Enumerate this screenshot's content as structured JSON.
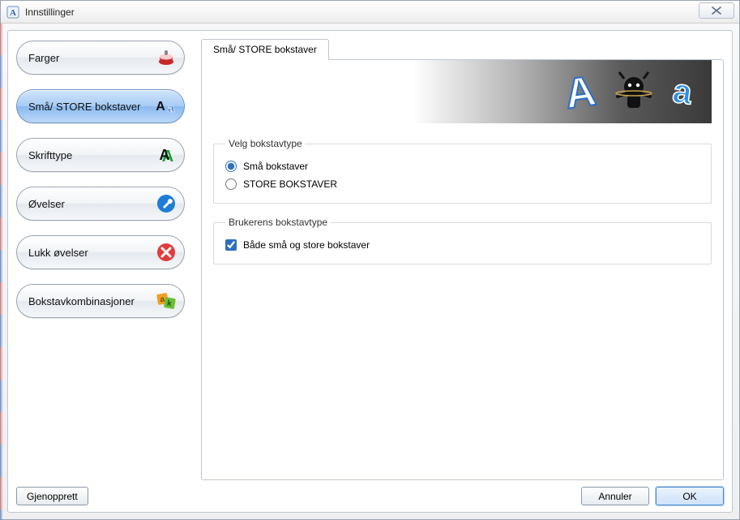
{
  "window": {
    "title": "Innstillinger"
  },
  "sidebar": {
    "items": [
      {
        "label": "Farger",
        "icon": "paint-bucket-icon"
      },
      {
        "label": "Små/ STORE bokstaver",
        "icon": "letters-aa-icon"
      },
      {
        "label": "Skrifttype",
        "icon": "font-a-icon"
      },
      {
        "label": "Øvelser",
        "icon": "wrench-icon"
      },
      {
        "label": "Lukk øvelser",
        "icon": "close-circle-icon"
      },
      {
        "label": "Bokstavkombinasjoner",
        "icon": "letter-blocks-icon"
      }
    ],
    "active_index": 1
  },
  "tab": {
    "label": "Små/ STORE bokstaver"
  },
  "group1": {
    "legend": "Velg bokstavtype",
    "options": [
      {
        "label": "Små bokstaver",
        "checked": true
      },
      {
        "label": "STORE BOKSTAVER",
        "checked": false
      }
    ]
  },
  "group2": {
    "legend": "Brukerens bokstavtype",
    "checkbox": {
      "label": "Både små og store bokstaver",
      "checked": true
    }
  },
  "buttons": {
    "restore": "Gjenopprett",
    "cancel": "Annuler",
    "ok": "OK"
  }
}
